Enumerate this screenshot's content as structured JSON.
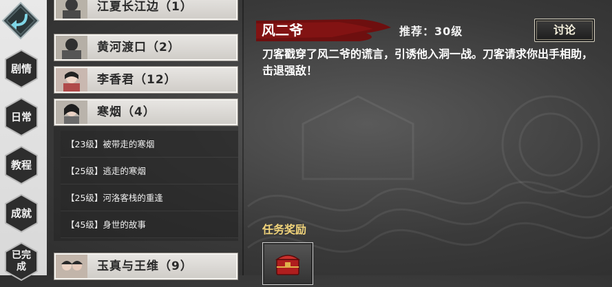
{
  "sidebar": {
    "items": [
      {
        "label": "剧情"
      },
      {
        "label": "日常"
      },
      {
        "label": "教程"
      },
      {
        "label": "成就"
      },
      {
        "label": "已完成"
      }
    ]
  },
  "quest_list": {
    "groups": [
      {
        "name": "江夏长江边（1）"
      },
      {
        "name": "黄河渡口（2）"
      },
      {
        "name": "李香君（12）"
      },
      {
        "name": "寒烟（4）"
      },
      {
        "name": "玉真与王维（9）"
      }
    ],
    "subquests": [
      {
        "label": "【23级】被带走的寒烟"
      },
      {
        "label": "【25级】逃走的寒烟"
      },
      {
        "label": "【25级】河洛客栈的重逢"
      },
      {
        "label": "【45级】身世的故事"
      }
    ]
  },
  "detail": {
    "title": "风二爷",
    "recommend": "推荐：30级",
    "discuss_label": "讨论",
    "description": "刀客戳穿了风二爷的谎言，引诱他入洞一战。刀客请求你出手相助，击退强敌！",
    "reward_label": "任务奖励",
    "reward_icon": "treasure-box-icon"
  },
  "colors": {
    "accent_red": "#7a1010",
    "reward_gold": "#f0d37a"
  }
}
